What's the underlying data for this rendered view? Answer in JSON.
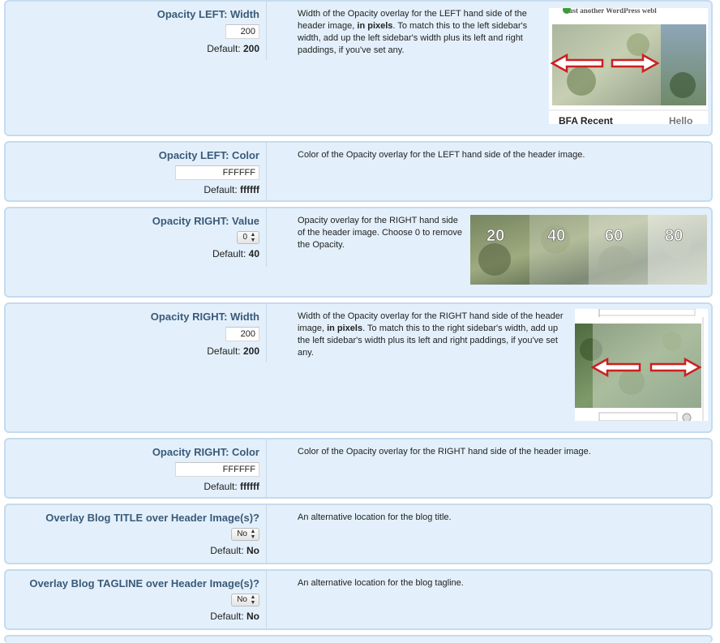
{
  "rows": [
    {
      "label": "Opacity LEFT: Width",
      "control": {
        "type": "input",
        "value": "200"
      },
      "default_label": "Default:",
      "default_value": "200",
      "description": "Width of the Opacity overlay for the LEFT hand side of the header image, {b}in pixels{/b}. To match this to the left sidebar's width, add up the left sidebar's width plus its left and right paddings, if you've set any.",
      "description_parts": [
        "Width of the Opacity overlay for the LEFT hand side of the header image, ",
        "in pixels",
        ". To match this to the left sidebar's width, add up the left sidebar's width plus its left and right paddings, if you've set any."
      ],
      "thumb": {
        "tagline": "Just another WordPress webl",
        "left_text": "BFA Recent",
        "right_text": "Hello"
      }
    },
    {
      "label": "Opacity LEFT: Color",
      "control": {
        "type": "input",
        "value": "FFFFFF"
      },
      "default_label": "Default:",
      "default_value": "ffffff",
      "description_parts": [
        "Color of the Opacity overlay for the LEFT hand side of the header image."
      ]
    },
    {
      "label": "Opacity RIGHT: Value",
      "control": {
        "type": "select",
        "value": "0"
      },
      "default_label": "Default:",
      "default_value": "40",
      "description_parts": [
        "Opacity overlay for the RIGHT hand side of the header image. Choose 0 to remove the Opacity."
      ],
      "thumb": {
        "steps": [
          "20",
          "40",
          "60",
          "80"
        ]
      }
    },
    {
      "label": "Opacity RIGHT: Width",
      "control": {
        "type": "input",
        "value": "200"
      },
      "default_label": "Default:",
      "default_value": "200",
      "description_parts": [
        "Width of the Opacity overlay for the RIGHT hand side of the header image, ",
        "in pixels",
        ". To match this to the right sidebar's width, add up the left sidebar's width plus its left and right paddings, if you've set any."
      ]
    },
    {
      "label": "Opacity RIGHT: Color",
      "control": {
        "type": "input",
        "value": "FFFFFF"
      },
      "default_label": "Default:",
      "default_value": "ffffff",
      "description_parts": [
        "Color of the Opacity overlay for the RIGHT hand side of the header image."
      ]
    },
    {
      "label": "Overlay Blog TITLE over Header Image(s)?",
      "control": {
        "type": "select",
        "value": "No"
      },
      "default_label": "Default:",
      "default_value": "No",
      "description_parts": [
        "An alternative location for the blog title."
      ]
    },
    {
      "label": "Overlay Blog TAGLINE over Header Image(s)?",
      "control": {
        "type": "select",
        "value": "No"
      },
      "default_label": "Default:",
      "default_value": "No",
      "description_parts": [
        "An alternative location for the blog tagline."
      ]
    }
  ],
  "colors": {
    "panel_bg": "#e3f0fb",
    "panel_border": "#c5dbee",
    "label": "#3a5a78",
    "arrow_red": "#cc1f1f"
  }
}
